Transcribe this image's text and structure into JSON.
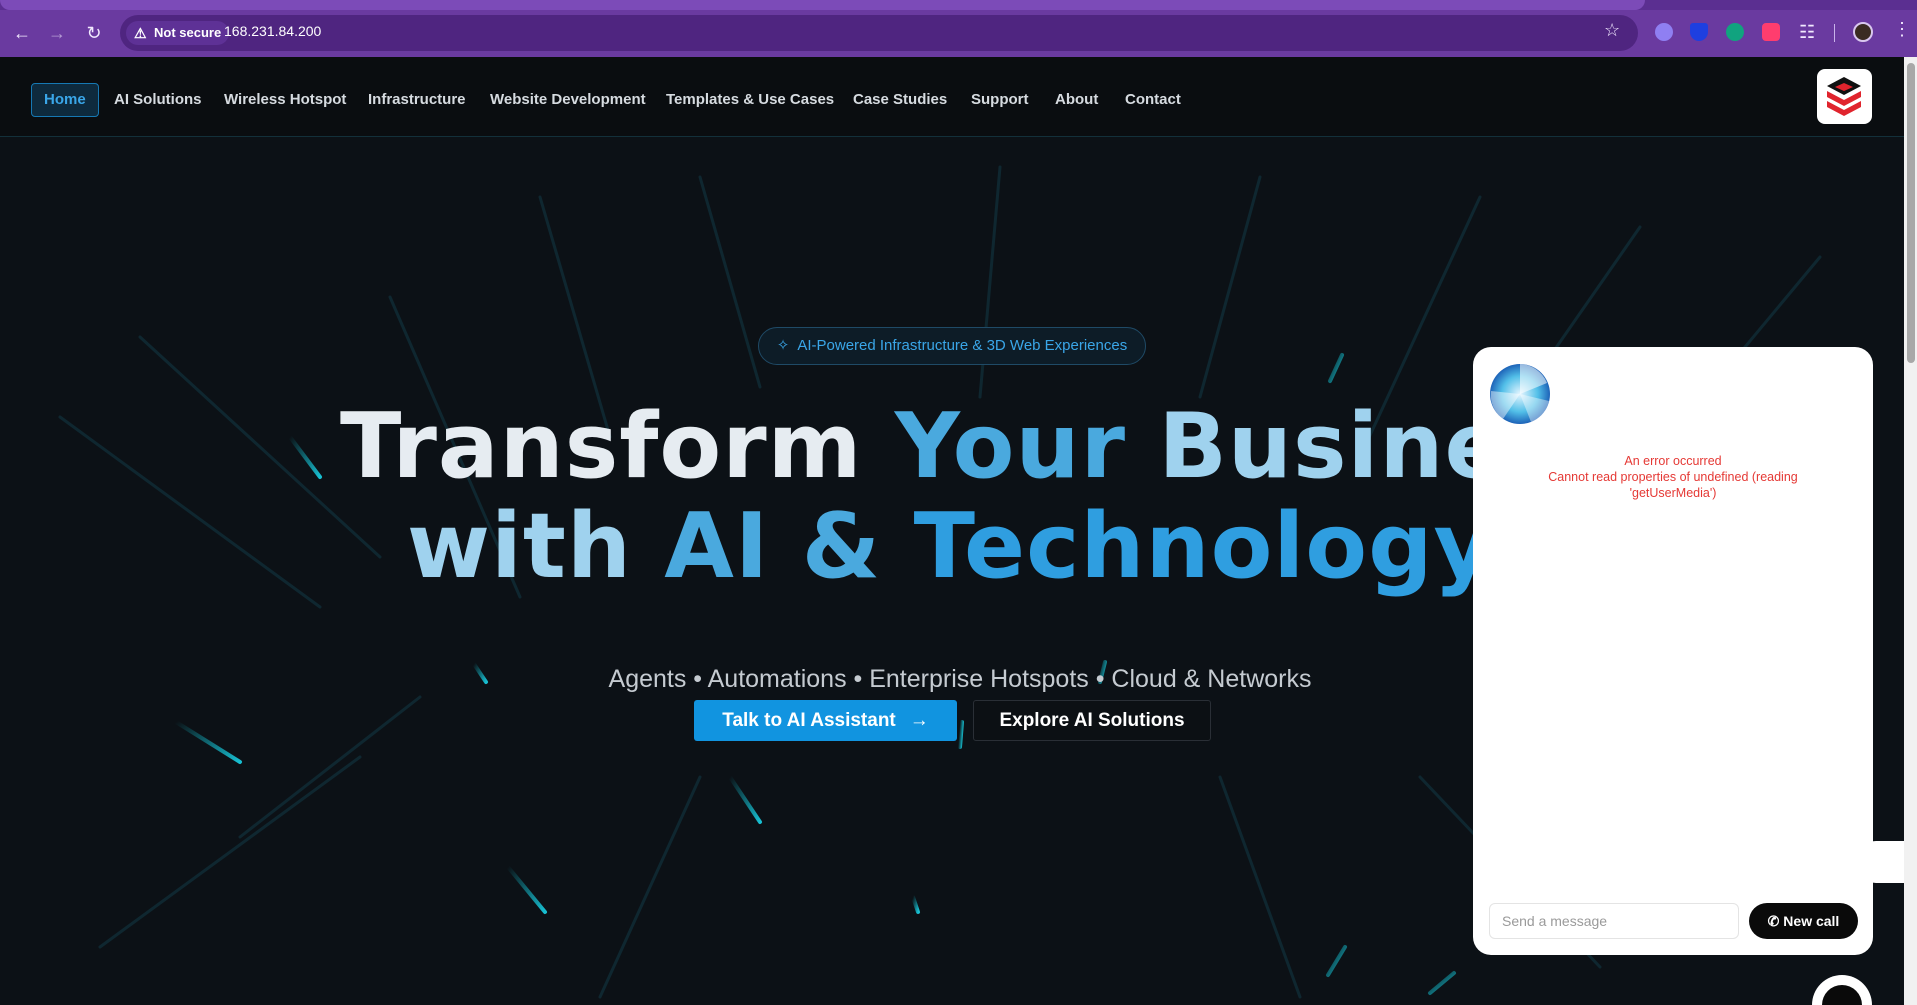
{
  "browser": {
    "security_label": "Not secure",
    "url": "168.231.84.200",
    "icons": [
      "back-icon",
      "forward-icon",
      "reload-icon",
      "warning-icon",
      "star-icon",
      "extensions-icon",
      "profile-avatar",
      "menu-icon"
    ]
  },
  "nav": {
    "items": [
      {
        "label": "Home",
        "active": true
      },
      {
        "label": "AI Solutions"
      },
      {
        "label": "Wireless Hotspot"
      },
      {
        "label": "Infrastructure"
      },
      {
        "label": "Website Development"
      },
      {
        "label": "Templates & Use Cases"
      },
      {
        "label": "Case Studies"
      },
      {
        "label": "Support"
      },
      {
        "label": "About"
      },
      {
        "label": "Contact"
      }
    ]
  },
  "hero": {
    "badge": "AI-Powered Infrastructure & 3D Web Experiences",
    "headline_line1": {
      "w1": "Transform",
      "w2": "Your",
      "w3": "Busines"
    },
    "headline_line2": {
      "w1": "with",
      "w2": "AI",
      "w3": "&",
      "w4": "Technology"
    },
    "subhead": "Agents • Automations • Enterprise Hotspots • Cloud & Networks",
    "primary_cta": "Talk to AI Assistant",
    "secondary_cta": "Explore AI Solutions"
  },
  "chat": {
    "error_title": "An error occurred",
    "error_detail": "Cannot read properties of undefined (reading 'getUserMedia')",
    "input_placeholder": "Send a message",
    "new_call_label": "New call"
  },
  "colors": {
    "accent": "#1194e0",
    "browser_frame": "#6a3aa0",
    "error": "#e53935",
    "background": "#0c1116"
  }
}
